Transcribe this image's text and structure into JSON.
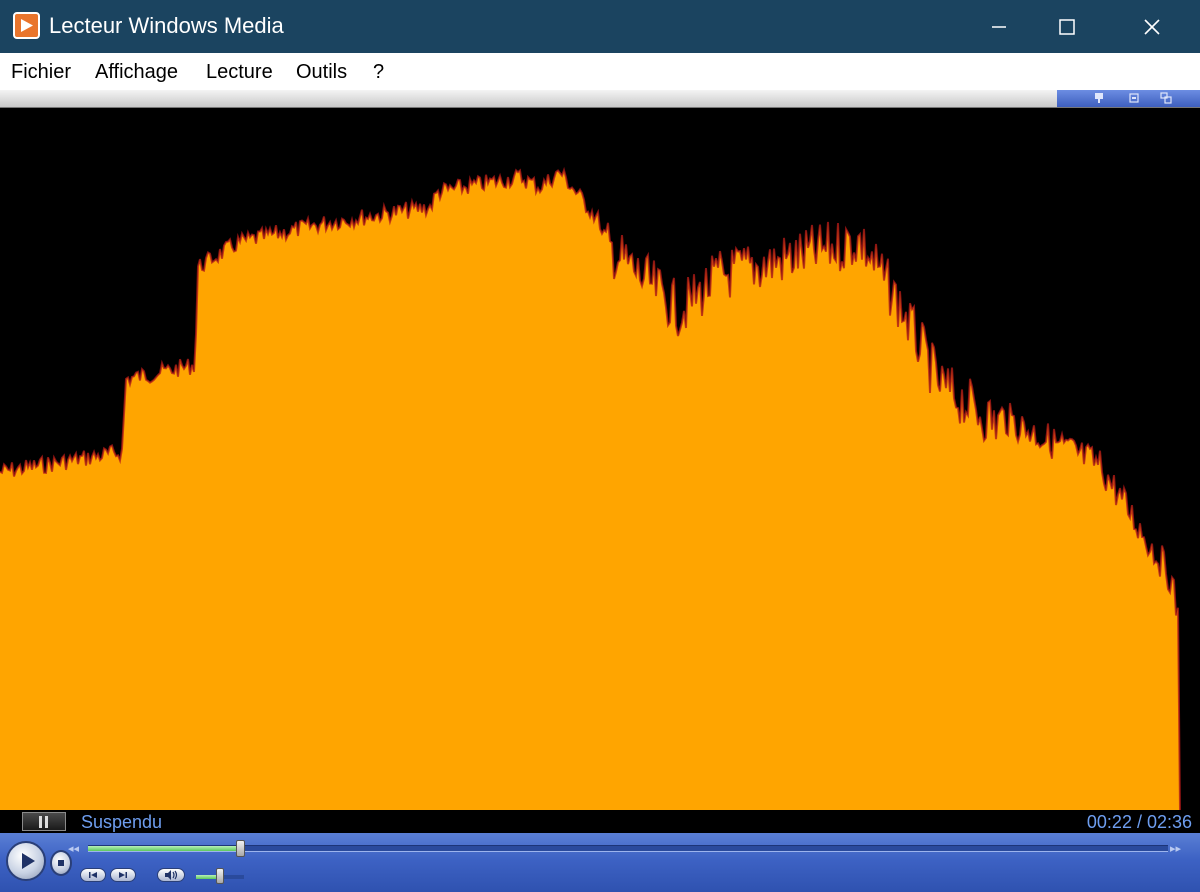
{
  "window": {
    "title": "Lecteur Windows Media",
    "app_icon": "wmp-play-icon",
    "controls": [
      "minimize-icon",
      "maximize-icon",
      "close-icon"
    ]
  },
  "menu": {
    "items": [
      {
        "label": "Fichier"
      },
      {
        "label": "Affichage"
      },
      {
        "label": "Lecture"
      },
      {
        "label": "Outils"
      },
      {
        "label": "?"
      }
    ]
  },
  "toolbar": {
    "icons": [
      "skin-icon",
      "compact-mode-icon",
      "switch-library-icon"
    ]
  },
  "visualization": {
    "type": "spectrum-bars",
    "fill_color": "#ffa500",
    "edge_color": "#b31818",
    "background_color": "#000000"
  },
  "status": {
    "state_text": "Suspendu",
    "time": "00:22 / 02:36"
  },
  "playback": {
    "progress": 0.141,
    "volume": 0.5
  },
  "colors": {
    "titlebar": "#1b4460",
    "status_text": "#6e9ef0",
    "controls_bar": "#3d62c4"
  }
}
